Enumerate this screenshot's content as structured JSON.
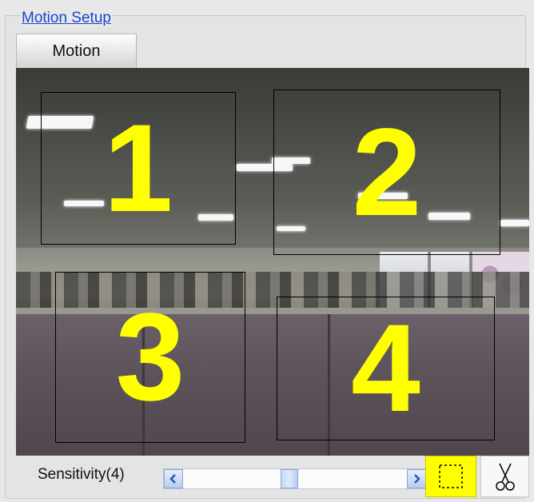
{
  "panel": {
    "title": "Motion Setup"
  },
  "tabs": [
    {
      "label": "Motion"
    }
  ],
  "zones": [
    {
      "number": "1"
    },
    {
      "number": "2"
    },
    {
      "number": "3"
    },
    {
      "number": "4"
    }
  ],
  "controls": {
    "sensitivity_label": "Sensitivity(4)",
    "sensitivity_level": 0.47,
    "icons": {
      "scroll_left": "chevron-left-icon",
      "scroll_right": "chevron-right-icon",
      "select_area": "dashed-rectangle-icon",
      "cut": "scissors-icon"
    }
  },
  "colors": {
    "zone_number": "#ffff00",
    "active_tool": "#ffff00",
    "title_link": "#1a44cc"
  }
}
